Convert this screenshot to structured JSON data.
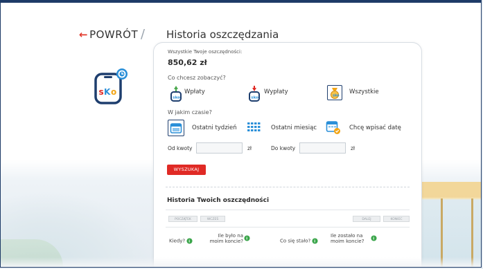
{
  "nav": {
    "back_label": "POWRÓT",
    "separator": "/",
    "page_title": "Historia oszczędzania"
  },
  "savings": {
    "label": "Wszystkie Twoje oszczędności:",
    "amount": "850,62 zł"
  },
  "what": {
    "label": "Co chcesz zobaczyć?",
    "options": [
      {
        "label": "Wpłaty",
        "icon": "deposit-icon"
      },
      {
        "label": "Wypłaty",
        "icon": "withdrawal-icon"
      },
      {
        "label": "Wszystkie",
        "icon": "all-icon",
        "selected": true
      }
    ]
  },
  "when": {
    "label": "W jakim czasie?",
    "options": [
      {
        "label": "Ostatni tydzień",
        "icon": "week-calendar-icon",
        "selected": true
      },
      {
        "label": "Ostatni miesiąc",
        "icon": "month-calendar-icon"
      },
      {
        "label": "Chcę wpisać datę",
        "icon": "custom-date-icon"
      }
    ]
  },
  "amount_filter": {
    "from_label": "Od kwoty",
    "to_label": "Do kwoty",
    "currency": "zł"
  },
  "search_button": "WYSZUKAJ",
  "history": {
    "title": "Historia Twoich oszczędności",
    "pager": {
      "first": "POCZĄTEK",
      "prev": "WCZEŚ",
      "next": "DALEJ",
      "last": "KONIEC"
    },
    "columns": [
      "Kiedy?",
      "Ile było na moim koncie?",
      "Co się stało?",
      "Ile zostało na moim koncie?"
    ]
  },
  "colors": {
    "accent_red": "#e02a25",
    "navy": "#1e3e6e",
    "logo_blue": "#2a8fd8"
  }
}
